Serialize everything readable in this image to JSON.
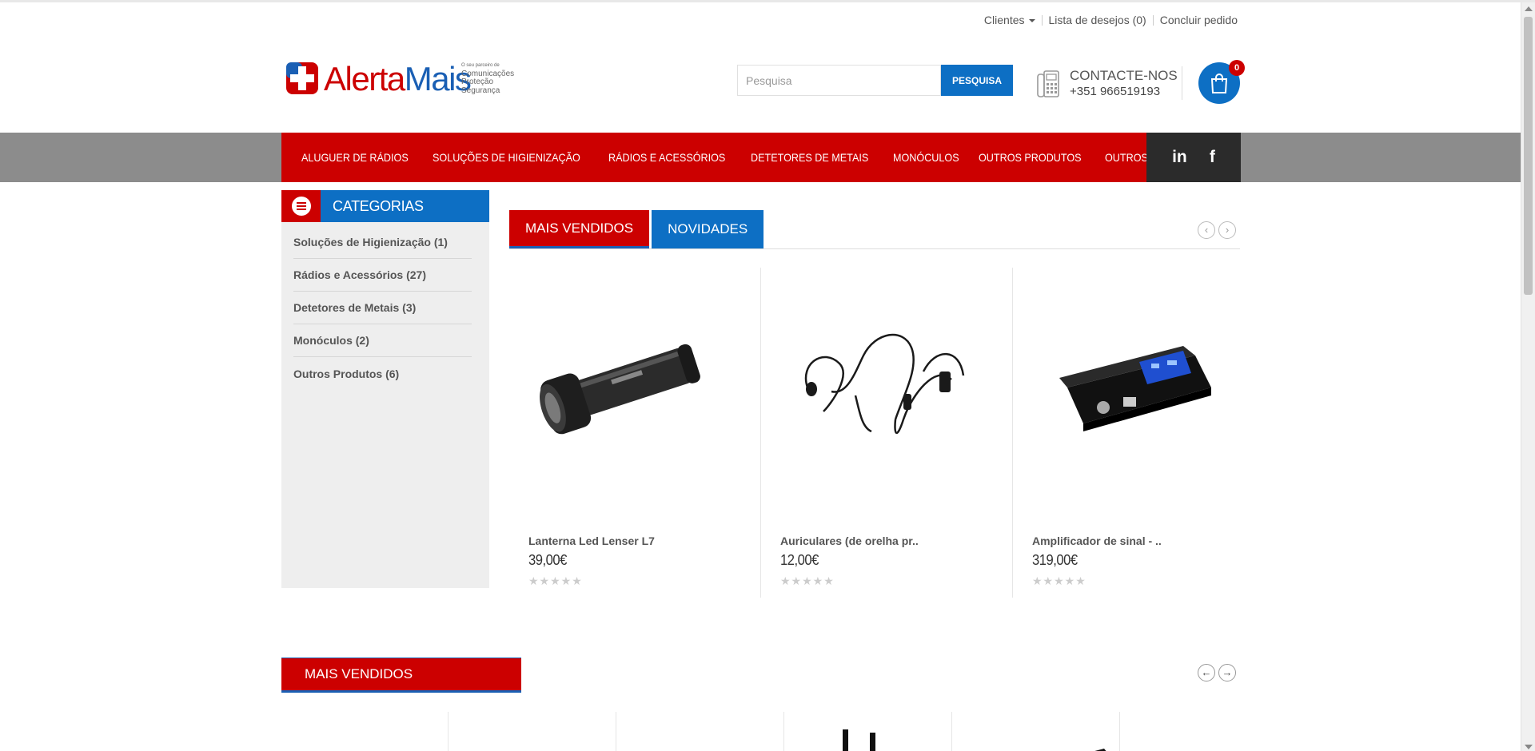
{
  "topbar": {
    "clients": "Clientes",
    "wishlist": "Lista de desejos (0)",
    "checkout": "Concluir pedido"
  },
  "logo": {
    "brand_part1": "Alerta",
    "brand_part2": "Mais",
    "tagline_small": "O seu parceiro de",
    "tagline_1": "Comunicações",
    "tagline_2": "Proteção",
    "tagline_3": "Segurança"
  },
  "search": {
    "placeholder": "Pesquisa",
    "button": "PESQUISA"
  },
  "contact": {
    "label": "CONTACTE-NOS",
    "phone": "+351 966519193"
  },
  "cart": {
    "count": "0"
  },
  "nav": {
    "items": [
      "ALUGUER DE RÁDIOS",
      "SOLUÇÕES DE HIGIENIZAÇÃO",
      "RÁDIOS E ACESSÓRIOS",
      "DETETORES DE METAIS",
      "MONÓCULOS",
      "OUTROS PRODUTOS",
      "OUTROS SERVIÇOS"
    ],
    "social": [
      "in",
      "f"
    ]
  },
  "sidebar": {
    "title": "CATEGORIAS",
    "items": [
      "Soluções de Higienização (1)",
      "Rádios e Acessórios (27)",
      "Detetores de Metais (3)",
      "Monóculos (2)",
      "Outros Produtos (6)"
    ]
  },
  "tabs": {
    "best_sellers": "MAIS VENDIDOS",
    "new": "NOVIDADES"
  },
  "products": [
    {
      "name": "Lanterna Led Lenser L7",
      "price": "39,00€",
      "rating": 0
    },
    {
      "name": "Auriculares (de orelha pr..",
      "price": "12,00€",
      "rating": 0
    },
    {
      "name": "Amplificador de sinal - ..",
      "price": "319,00€",
      "rating": 0
    }
  ],
  "section2": {
    "title": "MAIS VENDIDOS"
  },
  "colors": {
    "brand_red": "#cc0000",
    "brand_blue": "#0d6fc4",
    "nav_band": "#8c8c8c",
    "social_bg": "#2b2b2b"
  }
}
